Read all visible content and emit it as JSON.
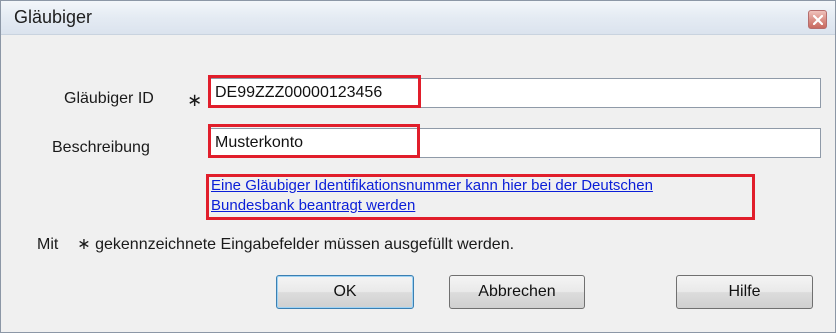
{
  "window": {
    "title": "Gläubiger"
  },
  "form": {
    "creditor_id": {
      "label": "Gläubiger ID",
      "required_marker": "∗",
      "value": "DE99ZZZ00000123456"
    },
    "description": {
      "label": "Beschreibung",
      "value": "Musterkonto"
    },
    "info_link": {
      "line1": "Eine Gläubiger Identifikationsnummer kann hier bei der Deutschen",
      "line2": "Bundesbank beantragt werden"
    },
    "footnote": {
      "prefix": "Mit",
      "marker": "∗",
      "text": "gekennzeichnete Eingabefelder müssen ausgefüllt werden."
    }
  },
  "buttons": {
    "ok": "OK",
    "cancel": "Abbrechen",
    "help": "Hilfe"
  },
  "icons": {
    "close": "close-icon"
  },
  "colors": {
    "highlight": "#e11e2b",
    "link": "#0a1ed8"
  }
}
